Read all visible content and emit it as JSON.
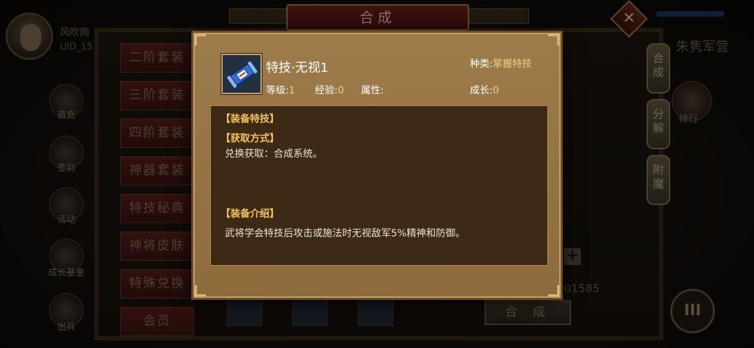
{
  "background": {
    "player_name": "风吹雨",
    "player_uid": "UID_15",
    "title": "合成",
    "close_symbol": "✕",
    "camp_label": "朱隽军营",
    "rank_label": "排行",
    "left_sidebar_labels": [
      "首充",
      "签到",
      "活动",
      "成长基金",
      "出兵"
    ],
    "left_tabs": [
      "二阶套装",
      "三阶套装",
      "四阶套装",
      "神器套装",
      "特技秘典",
      "神将皮肤",
      "特殊兑换",
      "会员"
    ],
    "right_tabs": [
      "合成",
      "分解",
      "附魔"
    ],
    "menu_glyph": "III",
    "number_text": "01585",
    "plus_symbol": "+",
    "synth_button": "合 成"
  },
  "modal": {
    "item": {
      "name": "特技·无视1",
      "type_label": "种类:",
      "type_value": "掌握特技",
      "level_label": "等级:",
      "level_value": "1",
      "exp_label": "经验:",
      "exp_value": "0",
      "attr_label": "属性:",
      "growth_label": "成长:",
      "growth_value": "0",
      "icon_color": "#2f6fd6"
    },
    "sections": {
      "equip_title": "【装备特技】",
      "obtain_title": "【获取方式】",
      "obtain_text": "兑换获取：合成系统。",
      "intro_title": "【装备介绍】",
      "intro_text": "武将学会特技后攻击或施法时无视敌军5%精神和防御。"
    }
  }
}
